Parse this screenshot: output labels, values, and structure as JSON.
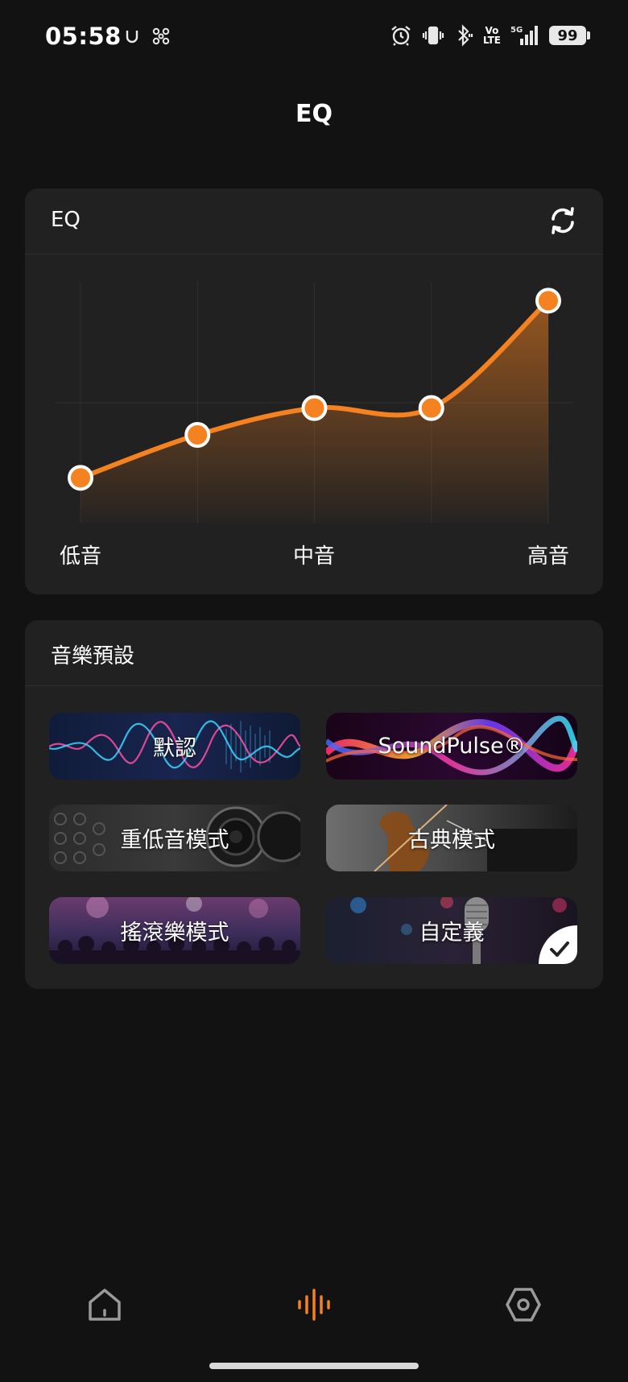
{
  "status_bar": {
    "time": "05:58",
    "left_icons": [
      "u-icon",
      "fan-icon"
    ],
    "right_icons": [
      "alarm-icon",
      "vibrate-icon",
      "bluetooth-icon",
      "volte-icon",
      "signal-5g-icon"
    ],
    "volte_text": "Vo\nLTE",
    "network": "5G",
    "battery": "99"
  },
  "header": {
    "title": "EQ"
  },
  "eq_card": {
    "title": "EQ",
    "reset_icon": "refresh-icon",
    "band_labels": [
      "低音",
      "中音",
      "高音"
    ],
    "accent_color": "#f58220"
  },
  "chart_data": {
    "type": "line",
    "x": [
      1,
      2,
      3,
      4,
      5
    ],
    "values": [
      -2.8,
      -1.2,
      -0.2,
      -0.2,
      3.8
    ],
    "ylim": [
      -4.5,
      4.5
    ],
    "grid": true,
    "area_fill": true,
    "band_labels": [
      "低音",
      "中音",
      "高音"
    ]
  },
  "presets_card": {
    "title": "音樂預設",
    "items": [
      {
        "label": "默認",
        "theme": "waveform"
      },
      {
        "label": "SoundPulse®",
        "theme": "neon-wave"
      },
      {
        "label": "重低音模式",
        "theme": "speaker"
      },
      {
        "label": "古典模式",
        "theme": "violin"
      },
      {
        "label": "搖滾樂模式",
        "theme": "concert"
      },
      {
        "label": "自定義",
        "theme": "microphone",
        "selected": true
      }
    ]
  },
  "bottom_nav": {
    "items": [
      {
        "icon": "home-icon",
        "active": false
      },
      {
        "icon": "equalizer-icon",
        "active": true
      },
      {
        "icon": "settings-icon",
        "active": false
      }
    ],
    "active_color": "#f58220",
    "inactive_color": "#9a9a9a"
  }
}
